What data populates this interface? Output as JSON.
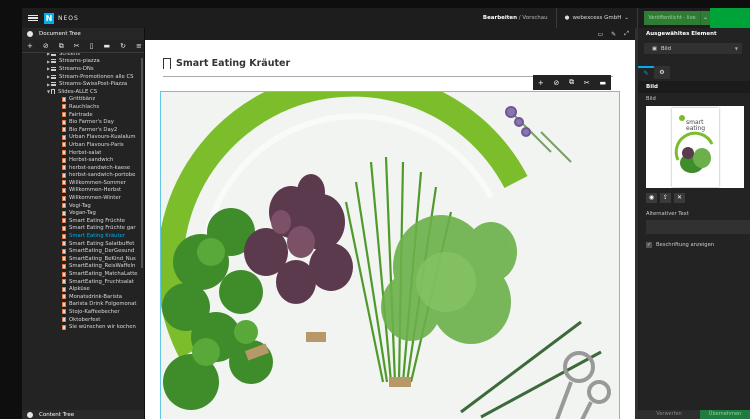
{
  "topbar": {
    "brand": "NEOS",
    "mode_edit": "Bearbeiten",
    "mode_sep": " / ",
    "mode_preview": "Vorschau",
    "user": "webexcess GmbH",
    "publish": "Veröffentlicht - live"
  },
  "document_tree": {
    "title": "Document Tree",
    "items": [
      {
        "label": "Screens",
        "icon": "list",
        "expanded": false
      },
      {
        "label": "Streams-piazza",
        "icon": "list",
        "expanded": false
      },
      {
        "label": "Streams-DNs",
        "icon": "list",
        "expanded": false
      },
      {
        "label": "Stream-Promotionen alle CS",
        "icon": "list",
        "expanded": false
      },
      {
        "label": "Streams-SwissPost-Piazza",
        "icon": "list",
        "expanded": false
      },
      {
        "label": "Slides-ALLE CS",
        "icon": "bookmark",
        "expanded": true
      },
      {
        "label": "Grittibänz",
        "icon": "page"
      },
      {
        "label": "Rauchlachs",
        "icon": "page"
      },
      {
        "label": "Fairtrade",
        "icon": "page"
      },
      {
        "label": "Bio Farmer's Day",
        "icon": "page"
      },
      {
        "label": "Bio Farmer's Day2",
        "icon": "page"
      },
      {
        "label": "Urban Flavours-Kualalum",
        "icon": "page"
      },
      {
        "label": "Urban Flavours-Paris",
        "icon": "page"
      },
      {
        "label": "Herbst-salat",
        "icon": "page"
      },
      {
        "label": "Herbst-sandwich",
        "icon": "page"
      },
      {
        "label": "herbst-sandwich-kaese",
        "icon": "page"
      },
      {
        "label": "herbst-sandwich-portobe",
        "icon": "page"
      },
      {
        "label": "Willkommen-Sommer",
        "icon": "page"
      },
      {
        "label": "Willkommen-Herbst",
        "icon": "page"
      },
      {
        "label": "Willkommen-Winter",
        "icon": "page"
      },
      {
        "label": "Vegi-Tag",
        "icon": "page"
      },
      {
        "label": "Vegan-Tag",
        "icon": "page"
      },
      {
        "label": "Smart Eating Früchte",
        "icon": "page"
      },
      {
        "label": "Smart Eating Früchte gar",
        "icon": "page"
      },
      {
        "label": "Smart Eating Kräuter",
        "icon": "page",
        "active": true
      },
      {
        "label": "Smart Eating Salatbuffet",
        "icon": "page"
      },
      {
        "label": "SmartEating_DerGesund",
        "icon": "page"
      },
      {
        "label": "SmartEating_BeKind_Nus",
        "icon": "page"
      },
      {
        "label": "SmartEating_ReisWaffeln",
        "icon": "page"
      },
      {
        "label": "SmartEating_MatchaLatte",
        "icon": "page"
      },
      {
        "label": "SmartEating_Fruchtsalat",
        "icon": "page"
      },
      {
        "label": "Alpküse",
        "icon": "page"
      },
      {
        "label": "Monatsdrink-Barista",
        "icon": "page"
      },
      {
        "label": "Barista Drink Folgemonat",
        "icon": "page"
      },
      {
        "label": "Stojo-Kaffeebecher",
        "icon": "page"
      },
      {
        "label": "Oktoberfest",
        "icon": "page"
      },
      {
        "label": "Sie wünschen wir kochen",
        "icon": "page"
      }
    ]
  },
  "content_tree": {
    "title": "Content Tree"
  },
  "canvas": {
    "headline": "Smart Eating Kräuter"
  },
  "inspector": {
    "title": "Ausgewähltes Element",
    "node_type": "Bild",
    "section": "Bild",
    "image_label": "Bild",
    "book_title_line1": "smart",
    "book_title_line2": "eating",
    "alt_label": "Alternativer Text",
    "caption_label": "Beschriftung anzeigen",
    "discard": "Verwerfen",
    "apply": "Übernehmen"
  },
  "colors": {
    "accent": "#00adee",
    "publish_green": "#00a338",
    "herb_arc": "#7cbd2c"
  }
}
